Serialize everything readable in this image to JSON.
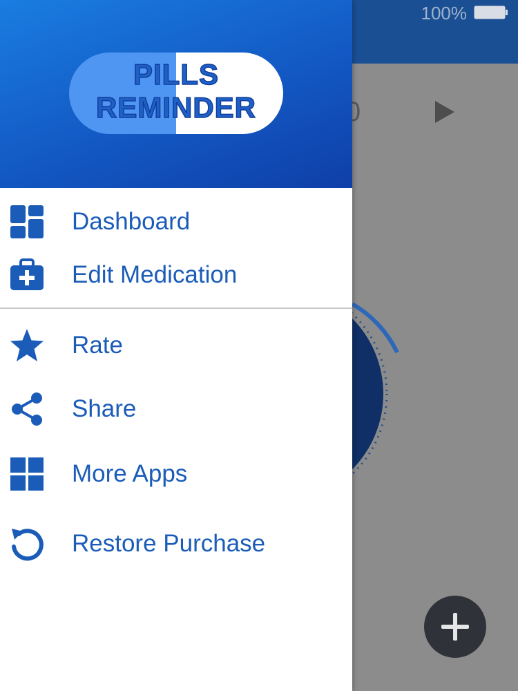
{
  "status_bar": {
    "battery_percent": "100%"
  },
  "background_app": {
    "partial_number": "0",
    "fab_icon": "plus-icon"
  },
  "drawer": {
    "logo": {
      "line1": "PILLS",
      "line2": "REMINDER"
    },
    "menu_primary": [
      {
        "label": "Dashboard",
        "icon": "dashboard-icon"
      },
      {
        "label": "Edit Medication",
        "icon": "medical-kit-icon"
      }
    ],
    "menu_secondary": [
      {
        "label": "Rate",
        "icon": "star-icon"
      },
      {
        "label": "Share",
        "icon": "share-icon"
      },
      {
        "label": "More Apps",
        "icon": "grid-icon"
      },
      {
        "label": "Restore Purchase",
        "icon": "restore-icon"
      }
    ]
  },
  "colors": {
    "accent": "#1a5cb8",
    "header_start": "#1a7de0",
    "header_end": "#0f3fa8",
    "dim_overlay": "#8c8c8c"
  }
}
